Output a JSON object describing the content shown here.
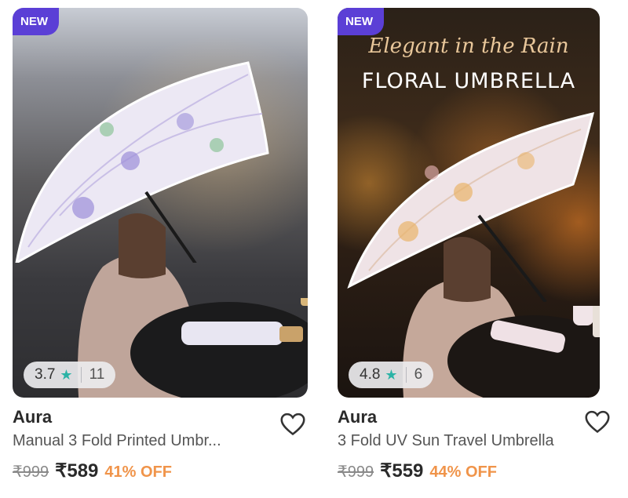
{
  "products": [
    {
      "badge": "NEW",
      "rating": "3.7",
      "rating_icon": "star-icon",
      "rating_count": "11",
      "brand": "Aura",
      "name": "Manual 3 Fold Printed Umbr...",
      "mrp": "₹999",
      "price": "₹589",
      "discount": "41% OFF"
    },
    {
      "badge": "NEW",
      "promo_script": "Elegant in the Rain",
      "promo_title": "FLORAL UMBRELLA",
      "rating": "4.8",
      "rating_icon": "star-icon",
      "rating_count": "6",
      "brand": "Aura",
      "name": "3 Fold UV Sun Travel Umbrella",
      "mrp": "₹999",
      "price": "₹559",
      "discount": "44% OFF"
    }
  ],
  "colors": {
    "badge": "#5b3fd6",
    "star": "#2bb3a6",
    "discount": "#f0944a"
  }
}
